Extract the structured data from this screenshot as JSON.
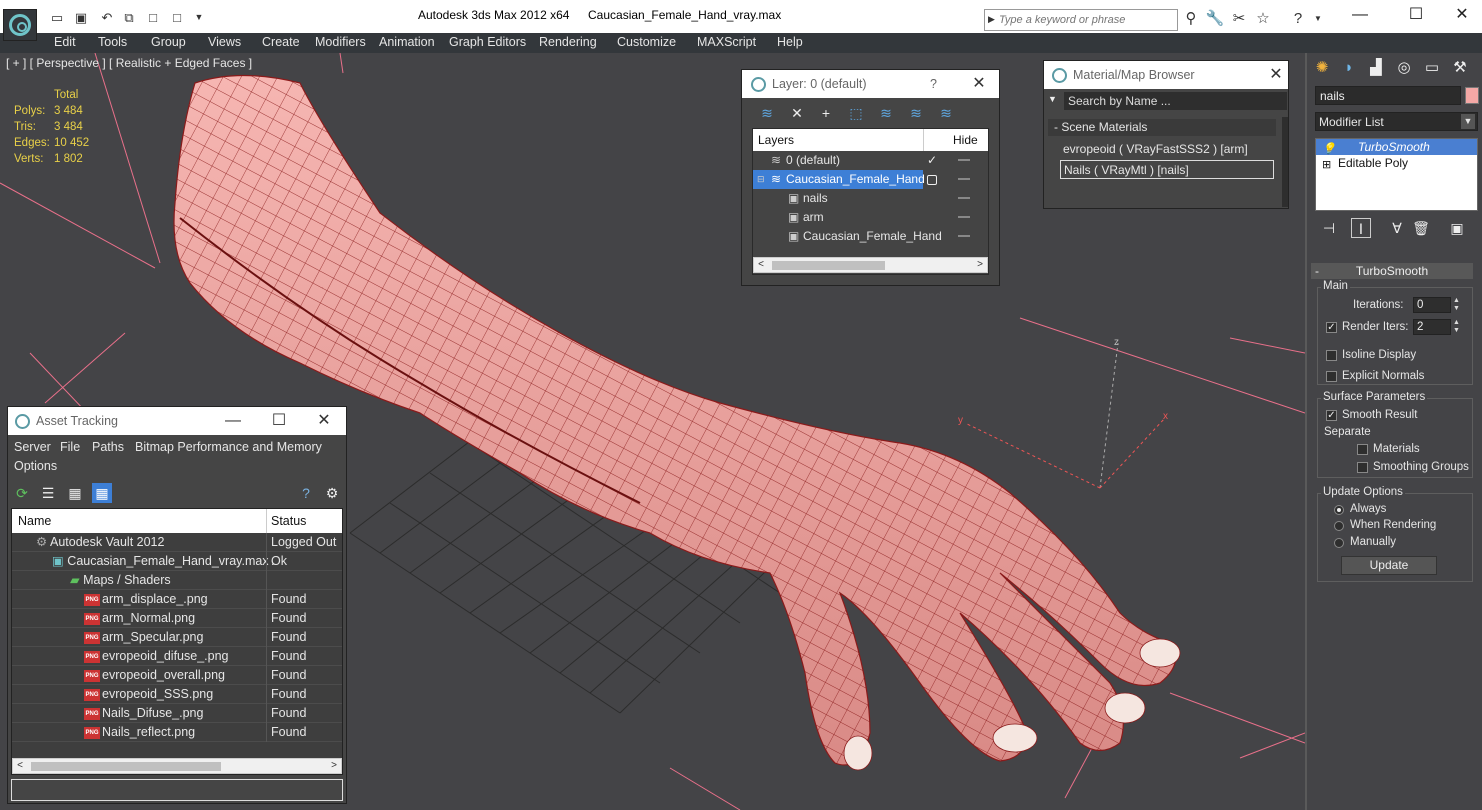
{
  "titlebar": {
    "app_title": "Autodesk 3ds Max  2012 x64",
    "file_title": "Caucasian_Female_Hand_vray.max",
    "search_placeholder": "Type a keyword or phrase"
  },
  "menu": [
    "Edit",
    "Tools",
    "Group",
    "Views",
    "Create",
    "Modifiers",
    "Animation",
    "Graph Editors",
    "Rendering",
    "Customize",
    "MAXScript",
    "Help"
  ],
  "viewport": {
    "label": "[ + ] [ Perspective ] [ Realistic + Edged Faces ]",
    "stats": {
      "total_label": "Total",
      "rows": [
        {
          "label": "Polys:",
          "value": "3 484"
        },
        {
          "label": "Tris:",
          "value": "3 484"
        },
        {
          "label": "Edges:",
          "value": "10 452"
        },
        {
          "label": "Verts:",
          "value": "1 802"
        }
      ]
    },
    "gizmo": {
      "z": "z",
      "y": "y",
      "x": "x"
    },
    "colors": {
      "mesh_fill": "#f0a8a4",
      "wire": "#8a1a1a",
      "bg": "#444447",
      "grid": "#2a2a2a"
    }
  },
  "layer_dialog": {
    "title": "Layer: 0 (default)",
    "help": "?",
    "headers": {
      "layers": "Layers",
      "hide": "Hide"
    },
    "rows": [
      {
        "name": "0 (default)",
        "checked": true
      },
      {
        "name": "Caucasian_Female_Hand",
        "selected": true
      },
      {
        "name": "nails"
      },
      {
        "name": "arm"
      },
      {
        "name": "Caucasian_Female_Hand"
      }
    ]
  },
  "material_browser": {
    "title": "Material/Map Browser",
    "search_placeholder": "Search by Name ...",
    "section": "- Scene Materials",
    "materials": [
      "evropeoid  ( VRayFastSSS2 ) [arm]",
      "Nails  ( VRayMtl ) [nails]"
    ]
  },
  "asset_tracking": {
    "title": "Asset Tracking",
    "menu": [
      "Server",
      "File",
      "Paths",
      "Bitmap Performance and Memory",
      "Options"
    ],
    "headers": {
      "name": "Name",
      "status": "Status"
    },
    "rows": [
      {
        "name": "Autodesk Vault 2012",
        "status": "Logged Out ."
      },
      {
        "name": "Caucasian_Female_Hand_vray.max",
        "status": "Ok"
      },
      {
        "name": "Maps / Shaders",
        "status": ""
      },
      {
        "name": "arm_displace_.png",
        "status": "Found"
      },
      {
        "name": "arm_Normal.png",
        "status": "Found"
      },
      {
        "name": "arm_Specular.png",
        "status": "Found"
      },
      {
        "name": "evropeoid_difuse_.png",
        "status": "Found"
      },
      {
        "name": "evropeoid_overall.png",
        "status": "Found"
      },
      {
        "name": "evropeoid_SSS.png",
        "status": "Found"
      },
      {
        "name": "Nails_Difuse_.png",
        "status": "Found"
      },
      {
        "name": "Nails_reflect.png",
        "status": "Found"
      }
    ],
    "png_badge": "PNG"
  },
  "command_panel": {
    "object_name": "nails",
    "object_color": "#f4a8a6",
    "modifier_list": "Modifier List",
    "stack": [
      {
        "label": "TurboSmooth",
        "selected": true
      },
      {
        "label": "Editable Poly"
      }
    ],
    "rollout_title": "TurboSmooth",
    "main": {
      "group": "Main",
      "iterations_label": "Iterations:",
      "iterations": "0",
      "render_iters_label": "Render Iters:",
      "render_iters": "2",
      "isoline": "Isoline Display",
      "explicit": "Explicit Normals"
    },
    "surface": {
      "group": "Surface Parameters",
      "smooth_result": "Smooth Result",
      "separate": "Separate",
      "materials": "Materials",
      "smoothing_groups": "Smoothing Groups"
    },
    "update": {
      "group": "Update Options",
      "always": "Always",
      "when_rendering": "When Rendering",
      "manually": "Manually",
      "button": "Update"
    }
  }
}
